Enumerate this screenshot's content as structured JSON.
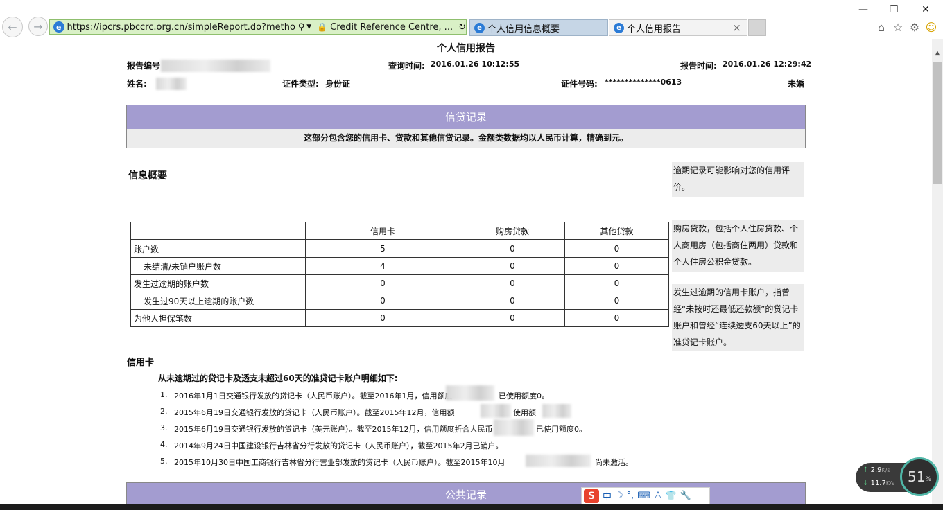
{
  "browser": {
    "url": "https://ipcrs.pbccrc.org.cn/simpleReport.do?method=viewl",
    "site_identity": "Credit Reference Centre, ...",
    "tabs": [
      {
        "label": "个人信用信息概要",
        "active": false
      },
      {
        "label": "个人信用报告",
        "active": true
      }
    ],
    "close_tab_glyph": "×"
  },
  "report": {
    "title": "个人信用报告",
    "report_no_label": "报告编号",
    "query_time_label": "查询时间:",
    "query_time": "2016.01.26 10:12:55",
    "report_time_label": "报告时间:",
    "report_time": "2016.01.26 12:29:42",
    "name_label": "姓名:",
    "id_type_label": "证件类型:",
    "id_type": "身份证",
    "id_no_label": "证件号码:",
    "id_no": "**************0613",
    "marital_status": "未婚"
  },
  "credit_section": {
    "header": "信贷记录",
    "subheader": "这部分包含您的信用卡、贷款和其他信贷记录。金额类数据均以人民币计算，精确到元。"
  },
  "summary": {
    "title": "信息概要",
    "columns": [
      "",
      "信用卡",
      "购房贷款",
      "其他贷款"
    ],
    "rows": [
      {
        "label": "账户数",
        "values": [
          "5",
          "0",
          "0"
        ]
      },
      {
        "label": "未结清/未销户账户数",
        "values": [
          "4",
          "0",
          "0"
        ]
      },
      {
        "label": "发生过逾期的账户数",
        "values": [
          "0",
          "0",
          "0"
        ]
      },
      {
        "label": "发生过90天以上逾期的账户数",
        "values": [
          "0",
          "0",
          "0"
        ]
      },
      {
        "label": "为他人担保笔数",
        "values": [
          "0",
          "0",
          "0"
        ]
      }
    ]
  },
  "notes": {
    "note1": "逾期记录可能影响对您的信用评价。",
    "note2": "购房贷款，包括个人住房贷款、个人商用房（包括商住两用）贷款和个人住房公积金贷款。",
    "note3": "发生过逾期的信用卡账户，指曾经“未按时还最低还款额”的贷记卡账户和曾经“连续透支60天以上”的准贷记卡账户。"
  },
  "credit_card": {
    "title": "信用卡",
    "intro": "从未逾期过的贷记卡及透支未超过60天的准贷记卡账户明细如下:",
    "items": [
      {
        "num": "1.",
        "text_a": "2016年1月1日交通银行发放的贷记卡（人民币账户）。截至2016年1月，信用额度",
        "text_b": "已使用额度0。"
      },
      {
        "num": "2.",
        "text_a": "2015年6月19日交通银行发放的贷记卡（人民币账户）。截至2015年12月，信用额",
        "text_b": "使用额"
      },
      {
        "num": "3.",
        "text_a": "2015年6月19日交通银行发放的贷记卡（美元账户）。截至2015年12月，信用额度折合人民币",
        "text_b": "已使用额度0。"
      },
      {
        "num": "4.",
        "text_a": "2014年9月24日中国建设银行吉林省分行发放的贷记卡（人民币账户），截至2015年2月已销户。",
        "text_b": ""
      },
      {
        "num": "5.",
        "text_a": "2015年10月30日中国工商银行吉林省分行营业部发放的贷记卡（人民币账户）。截至2015年10月",
        "text_b": "尚未激活。"
      }
    ]
  },
  "public_section": {
    "header": "公共记录"
  },
  "overlays": {
    "ime_items": [
      "中",
      "☽",
      "°,",
      "⌨",
      "♙",
      "👕",
      "🔧"
    ],
    "ime_logo": "S",
    "net_up": "2.9",
    "net_down": "11.7",
    "net_unit": "K/s",
    "gauge": "51",
    "gauge_unit": "%"
  }
}
